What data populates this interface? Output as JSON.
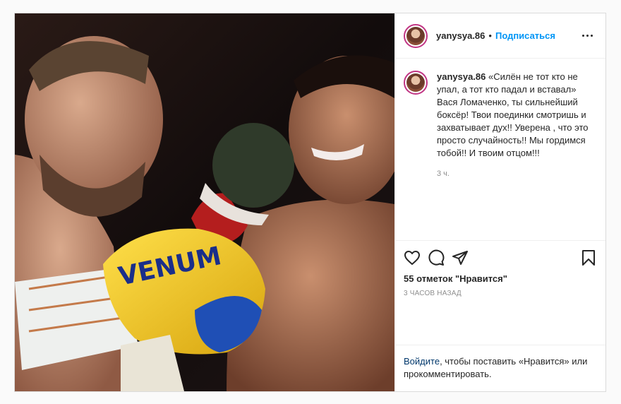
{
  "header": {
    "username": "yanysya.86",
    "separator": "•",
    "follow_label": "Подписаться"
  },
  "photo": {
    "glove_text": "VENUM",
    "colors": {
      "glove_yellow": "#f2c21a",
      "glove_blue": "#1f4fb5",
      "red_glove": "#b41e1e"
    }
  },
  "caption": {
    "username": "yanysya.86",
    "text": " «Силён не тот кто не упал, а тот кто падал и вставал» Вася Ломаченко, ты сильнейший боксёр! Твои поединки смотришь и захватывает дух!! Уверена , что это просто случайность!! Мы гордимся тобой!! И твоим отцом!!!",
    "time": "3 ч."
  },
  "actions": {
    "likes": "55 отметок \"Нравится\"",
    "timestamp": "3 ЧАСОВ НАЗАД"
  },
  "login": {
    "link": "Войдите",
    "text": ", чтобы поставить «Нравится» или прокомментировать."
  },
  "icons": [
    "heart-icon",
    "comment-icon",
    "share-icon",
    "bookmark-icon",
    "more-icon"
  ],
  "colors": {
    "accent": "#0095f6",
    "link": "#00376b",
    "muted": "#8e8e8e",
    "border": "#dbdbdb"
  }
}
